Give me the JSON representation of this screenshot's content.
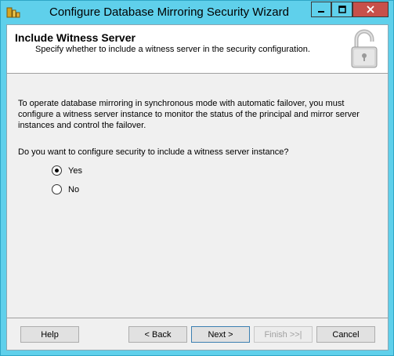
{
  "window": {
    "title": "Configure Database Mirroring Security Wizard"
  },
  "header": {
    "title": "Include Witness Server",
    "subtitle": "Specify whether to include a witness server in the security configuration."
  },
  "body": {
    "intro": "To operate database mirroring in synchronous mode with automatic failover, you must configure a witness server instance to monitor the status of the principal and mirror server instances and control the failover.",
    "question": "Do you want to configure security to include a witness server instance?",
    "options": [
      {
        "label": "Yes",
        "selected": true
      },
      {
        "label": "No",
        "selected": false
      }
    ]
  },
  "buttons": {
    "help": "Help",
    "back": "< Back",
    "next": "Next >",
    "finish": "Finish >>|",
    "cancel": "Cancel"
  },
  "colors": {
    "titlebar": "#5fd0eb",
    "close_button": "#c7504a",
    "client_bg": "#f0f0f0"
  },
  "icons": {
    "app": "database-wizard-icon",
    "header": "padlock-icon"
  }
}
